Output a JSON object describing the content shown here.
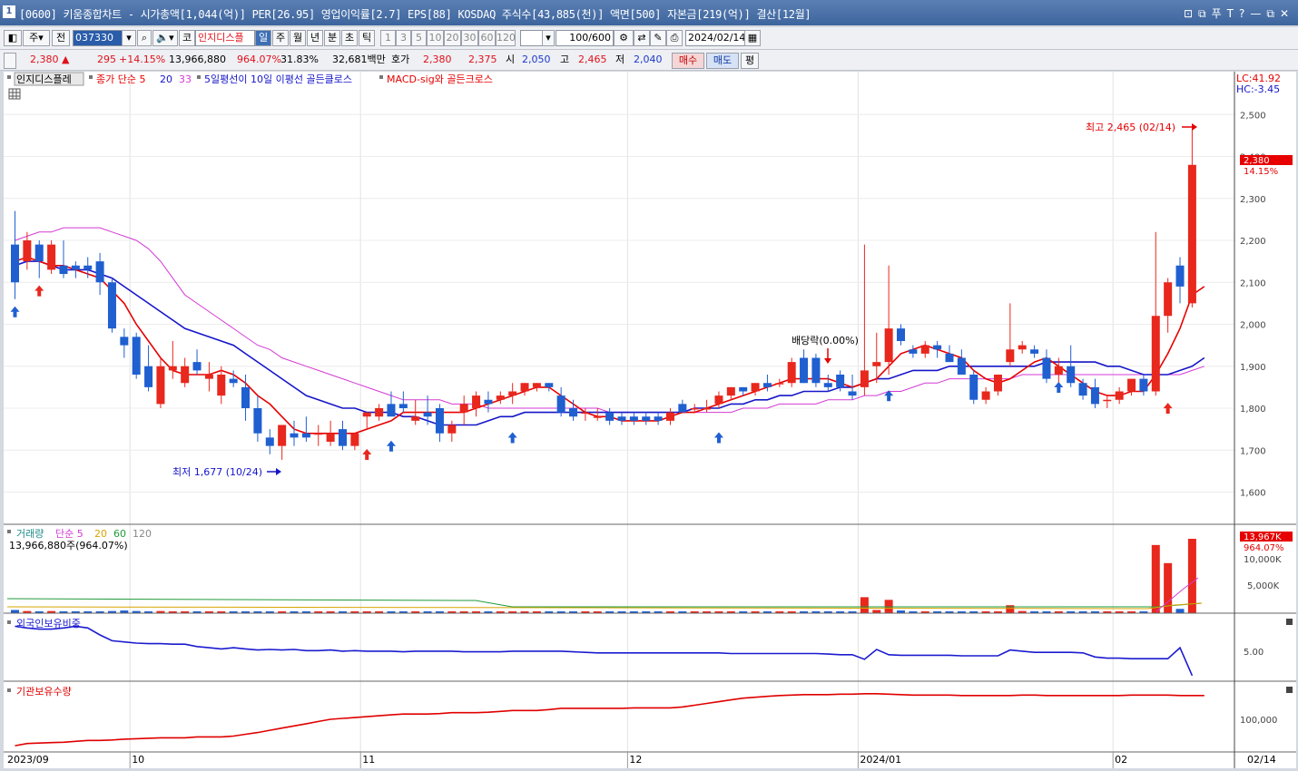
{
  "window": {
    "number": "1",
    "title": "[0600] 키움종합차트 - 시가총액[1,044(억)] PER[26.95] 영업이익률[2.7] EPS[88] KOSDAQ 주식수[43,885(천)] 액면[500] 자본금[219(억)] 결산[12월]",
    "buttons": [
      "⊡",
      "⧉",
      "푸",
      "T",
      "?",
      "—",
      "⧉",
      "✕"
    ]
  },
  "toolbar": {
    "period": "주",
    "scope": "전",
    "code": "037330",
    "stock_name": "인지디스플",
    "market_prefix": "코",
    "timeframes": [
      "일",
      "주",
      "월",
      "년",
      "분",
      "초",
      "틱"
    ],
    "selected_timeframe": "일",
    "intervals": [
      "1",
      "3",
      "5",
      "10",
      "20",
      "30",
      "60",
      "120"
    ],
    "count": "100/600",
    "date": "2024/02/14"
  },
  "quote": {
    "price": "2,380",
    "arrow": "▲",
    "change": "295",
    "change_pct": "+14.15%",
    "volume": "13,966,880",
    "volume_ratio": "964.07%",
    "turnover": "31.83%",
    "amount": "32,681백만",
    "ask_label": "호가",
    "ask": "2,380",
    "bid": "2,375",
    "open_label": "시",
    "open": "2,050",
    "high_label": "고",
    "high": "2,465",
    "low_label": "저",
    "low": "2,040",
    "buy_label": "매수",
    "sell_label": "매도",
    "eval_label": "평"
  },
  "legend": {
    "stock": "인지디스플레",
    "ma": "종가 단순 5",
    "ma20": "20",
    "ma33": "33",
    "sig1": "5일평선이 10일 이평선 골든클로스",
    "sig2": "MACD-sig와 골든크로스",
    "lc": "LC:41.92",
    "hc": "HC:-3.45",
    "high_note": "최고 2,465 (02/14)",
    "low_note": "최저 1,677 (10/24)",
    "dividend_note": "배당락(0.00%)",
    "last_price": "2,380",
    "last_pct": "14.15%"
  },
  "volume_panel": {
    "title": "거래량",
    "ma_label": "단순 5",
    "ma20": "20",
    "ma60": "60",
    "ma120": "120",
    "value_text": "13,966,880주(964.07%)",
    "last_value": "13,967K",
    "last_pct": "964.07%",
    "ticks": [
      "10,000K",
      "5,000K"
    ]
  },
  "foreign_panel": {
    "title": "외국인보유비중",
    "tick": "5.00"
  },
  "inst_panel": {
    "title": "기관보유수량",
    "tick": "100,000"
  },
  "xaxis": {
    "labels": [
      "2023/09",
      "10",
      "11",
      "12",
      "2024/01",
      "02",
      "02/14"
    ]
  },
  "colors": {
    "up": "#e8271d",
    "down": "#1f5fd0",
    "ma5": "#e60000",
    "ma20": "#1515c8",
    "ma33": "#d43ad4",
    "vol_ma20": "#d8a400",
    "vol_ma60": "#1f9a3a",
    "vol_ma120": "#888888",
    "foreign": "#1b1bd0",
    "inst": "#e00000"
  },
  "chart_data": {
    "type": "candlestick",
    "ylim": [
      1560,
      2520
    ],
    "y_ticks": [
      2500,
      2400,
      2300,
      2200,
      2100,
      2000,
      1900,
      1800,
      1700,
      1600
    ],
    "candles": [
      {
        "o": 2190,
        "h": 2270,
        "l": 2060,
        "c": 2100
      },
      {
        "o": 2150,
        "h": 2220,
        "l": 2130,
        "c": 2200
      },
      {
        "o": 2190,
        "h": 2200,
        "l": 2110,
        "c": 2150
      },
      {
        "o": 2130,
        "h": 2200,
        "l": 2120,
        "c": 2190
      },
      {
        "o": 2140,
        "h": 2200,
        "l": 2110,
        "c": 2120
      },
      {
        "o": 2140,
        "h": 2150,
        "l": 2110,
        "c": 2130
      },
      {
        "o": 2140,
        "h": 2160,
        "l": 2110,
        "c": 2130
      },
      {
        "o": 2150,
        "h": 2170,
        "l": 2070,
        "c": 2100
      },
      {
        "o": 2100,
        "h": 2110,
        "l": 1980,
        "c": 1990
      },
      {
        "o": 1970,
        "h": 1990,
        "l": 1920,
        "c": 1950
      },
      {
        "o": 1970,
        "h": 1980,
        "l": 1870,
        "c": 1880
      },
      {
        "o": 1900,
        "h": 1950,
        "l": 1840,
        "c": 1850
      },
      {
        "o": 1810,
        "h": 1920,
        "l": 1800,
        "c": 1900
      },
      {
        "o": 1890,
        "h": 1960,
        "l": 1870,
        "c": 1900
      },
      {
        "o": 1860,
        "h": 1920,
        "l": 1850,
        "c": 1900
      },
      {
        "o": 1910,
        "h": 1940,
        "l": 1880,
        "c": 1890
      },
      {
        "o": 1870,
        "h": 1910,
        "l": 1840,
        "c": 1880
      },
      {
        "o": 1830,
        "h": 1900,
        "l": 1810,
        "c": 1880
      },
      {
        "o": 1870,
        "h": 1890,
        "l": 1850,
        "c": 1860
      },
      {
        "o": 1850,
        "h": 1880,
        "l": 1770,
        "c": 1800
      },
      {
        "o": 1800,
        "h": 1830,
        "l": 1720,
        "c": 1740
      },
      {
        "o": 1730,
        "h": 1750,
        "l": 1690,
        "c": 1710
      },
      {
        "o": 1710,
        "h": 1760,
        "l": 1677,
        "c": 1760
      },
      {
        "o": 1740,
        "h": 1770,
        "l": 1710,
        "c": 1730
      },
      {
        "o": 1740,
        "h": 1780,
        "l": 1720,
        "c": 1730
      },
      {
        "o": 1740,
        "h": 1760,
        "l": 1710,
        "c": 1740
      },
      {
        "o": 1720,
        "h": 1770,
        "l": 1710,
        "c": 1740
      },
      {
        "o": 1750,
        "h": 1770,
        "l": 1700,
        "c": 1710
      },
      {
        "o": 1710,
        "h": 1740,
        "l": 1700,
        "c": 1740
      },
      {
        "o": 1780,
        "h": 1790,
        "l": 1750,
        "c": 1790
      },
      {
        "o": 1780,
        "h": 1810,
        "l": 1770,
        "c": 1800
      },
      {
        "o": 1810,
        "h": 1840,
        "l": 1790,
        "c": 1780
      },
      {
        "o": 1810,
        "h": 1840,
        "l": 1790,
        "c": 1800
      },
      {
        "o": 1770,
        "h": 1820,
        "l": 1760,
        "c": 1780
      },
      {
        "o": 1790,
        "h": 1830,
        "l": 1760,
        "c": 1780
      },
      {
        "o": 1800,
        "h": 1810,
        "l": 1720,
        "c": 1740
      },
      {
        "o": 1740,
        "h": 1770,
        "l": 1720,
        "c": 1760
      },
      {
        "o": 1790,
        "h": 1830,
        "l": 1760,
        "c": 1810
      },
      {
        "o": 1800,
        "h": 1840,
        "l": 1780,
        "c": 1830
      },
      {
        "o": 1820,
        "h": 1840,
        "l": 1790,
        "c": 1810
      },
      {
        "o": 1820,
        "h": 1840,
        "l": 1810,
        "c": 1830
      },
      {
        "o": 1830,
        "h": 1860,
        "l": 1810,
        "c": 1840
      },
      {
        "o": 1840,
        "h": 1860,
        "l": 1830,
        "c": 1860
      },
      {
        "o": 1850,
        "h": 1860,
        "l": 1840,
        "c": 1860
      },
      {
        "o": 1860,
        "h": 1860,
        "l": 1840,
        "c": 1850
      },
      {
        "o": 1830,
        "h": 1850,
        "l": 1780,
        "c": 1790
      },
      {
        "o": 1800,
        "h": 1820,
        "l": 1770,
        "c": 1780
      },
      {
        "o": 1790,
        "h": 1800,
        "l": 1770,
        "c": 1790
      },
      {
        "o": 1780,
        "h": 1800,
        "l": 1770,
        "c": 1780
      },
      {
        "o": 1790,
        "h": 1800,
        "l": 1760,
        "c": 1770
      },
      {
        "o": 1780,
        "h": 1790,
        "l": 1760,
        "c": 1770
      },
      {
        "o": 1780,
        "h": 1790,
        "l": 1760,
        "c": 1770
      },
      {
        "o": 1780,
        "h": 1790,
        "l": 1760,
        "c": 1770
      },
      {
        "o": 1780,
        "h": 1790,
        "l": 1760,
        "c": 1770
      },
      {
        "o": 1770,
        "h": 1800,
        "l": 1760,
        "c": 1790
      },
      {
        "o": 1810,
        "h": 1820,
        "l": 1790,
        "c": 1790
      },
      {
        "o": 1800,
        "h": 1810,
        "l": 1790,
        "c": 1800
      },
      {
        "o": 1800,
        "h": 1820,
        "l": 1790,
        "c": 1800
      },
      {
        "o": 1810,
        "h": 1840,
        "l": 1800,
        "c": 1830
      },
      {
        "o": 1830,
        "h": 1850,
        "l": 1820,
        "c": 1850
      },
      {
        "o": 1850,
        "h": 1850,
        "l": 1830,
        "c": 1840
      },
      {
        "o": 1840,
        "h": 1860,
        "l": 1830,
        "c": 1860
      },
      {
        "o": 1860,
        "h": 1880,
        "l": 1840,
        "c": 1850
      },
      {
        "o": 1860,
        "h": 1870,
        "l": 1850,
        "c": 1860
      },
      {
        "o": 1860,
        "h": 1920,
        "l": 1850,
        "c": 1910
      },
      {
        "o": 1920,
        "h": 1940,
        "l": 1860,
        "c": 1860
      },
      {
        "o": 1920,
        "h": 1930,
        "l": 1850,
        "c": 1860
      },
      {
        "o": 1860,
        "h": 1880,
        "l": 1840,
        "c": 1850
      },
      {
        "o": 1880,
        "h": 1890,
        "l": 1840,
        "c": 1850
      },
      {
        "o": 1840,
        "h": 1880,
        "l": 1820,
        "c": 1830
      },
      {
        "o": 1850,
        "h": 2190,
        "l": 1830,
        "c": 1890
      },
      {
        "o": 1900,
        "h": 1980,
        "l": 1860,
        "c": 1910
      },
      {
        "o": 1910,
        "h": 2140,
        "l": 1880,
        "c": 1990
      },
      {
        "o": 1990,
        "h": 2000,
        "l": 1950,
        "c": 1960
      },
      {
        "o": 1940,
        "h": 1950,
        "l": 1920,
        "c": 1930
      },
      {
        "o": 1930,
        "h": 1960,
        "l": 1920,
        "c": 1950
      },
      {
        "o": 1950,
        "h": 1960,
        "l": 1920,
        "c": 1940
      },
      {
        "o": 1930,
        "h": 1950,
        "l": 1910,
        "c": 1910
      },
      {
        "o": 1920,
        "h": 1940,
        "l": 1880,
        "c": 1880
      },
      {
        "o": 1880,
        "h": 1890,
        "l": 1810,
        "c": 1820
      },
      {
        "o": 1820,
        "h": 1850,
        "l": 1810,
        "c": 1840
      },
      {
        "o": 1840,
        "h": 1880,
        "l": 1830,
        "c": 1880
      },
      {
        "o": 1910,
        "h": 2050,
        "l": 1900,
        "c": 1940
      },
      {
        "o": 1940,
        "h": 1960,
        "l": 1930,
        "c": 1950
      },
      {
        "o": 1940,
        "h": 1950,
        "l": 1920,
        "c": 1930
      },
      {
        "o": 1920,
        "h": 1940,
        "l": 1860,
        "c": 1870
      },
      {
        "o": 1880,
        "h": 1920,
        "l": 1860,
        "c": 1900
      },
      {
        "o": 1900,
        "h": 1950,
        "l": 1850,
        "c": 1860
      },
      {
        "o": 1860,
        "h": 1870,
        "l": 1820,
        "c": 1830
      },
      {
        "o": 1850,
        "h": 1870,
        "l": 1800,
        "c": 1810
      },
      {
        "o": 1820,
        "h": 1830,
        "l": 1800,
        "c": 1820
      },
      {
        "o": 1820,
        "h": 1850,
        "l": 1810,
        "c": 1840
      },
      {
        "o": 1840,
        "h": 1870,
        "l": 1830,
        "c": 1870
      },
      {
        "o": 1870,
        "h": 1880,
        "l": 1830,
        "c": 1840
      },
      {
        "o": 1840,
        "h": 2220,
        "l": 1830,
        "c": 2020
      },
      {
        "o": 2020,
        "h": 2110,
        "l": 1980,
        "c": 2100
      },
      {
        "o": 2140,
        "h": 2160,
        "l": 2050,
        "c": 2090
      },
      {
        "o": 2050,
        "h": 2465,
        "l": 2040,
        "c": 2380
      }
    ],
    "ma5": [
      2150,
      2160,
      2150,
      2140,
      2140,
      2130,
      2120,
      2110,
      2080,
      2050,
      2000,
      1960,
      1920,
      1890,
      1880,
      1880,
      1880,
      1890,
      1880,
      1860,
      1830,
      1810,
      1780,
      1750,
      1740,
      1740,
      1740,
      1740,
      1740,
      1750,
      1760,
      1770,
      1790,
      1790,
      1790,
      1790,
      1790,
      1790,
      1800,
      1810,
      1820,
      1830,
      1840,
      1850,
      1850,
      1830,
      1810,
      1790,
      1780,
      1780,
      1770,
      1770,
      1770,
      1770,
      1780,
      1790,
      1790,
      1800,
      1810,
      1820,
      1830,
      1840,
      1850,
      1860,
      1870,
      1870,
      1870,
      1870,
      1860,
      1850,
      1860,
      1870,
      1900,
      1930,
      1940,
      1950,
      1940,
      1930,
      1920,
      1890,
      1870,
      1860,
      1870,
      1890,
      1910,
      1920,
      1900,
      1880,
      1860,
      1840,
      1830,
      1830,
      1840,
      1840,
      1880,
      1930,
      1990,
      2070,
      2090
    ],
    "ma20": [
      2140,
      2150,
      2150,
      2140,
      2130,
      2130,
      2130,
      2120,
      2110,
      2090,
      2070,
      2050,
      2030,
      2010,
      1990,
      1980,
      1970,
      1960,
      1950,
      1930,
      1910,
      1890,
      1870,
      1850,
      1830,
      1820,
      1810,
      1800,
      1800,
      1790,
      1790,
      1790,
      1780,
      1780,
      1770,
      1760,
      1760,
      1760,
      1760,
      1770,
      1780,
      1780,
      1790,
      1790,
      1790,
      1790,
      1790,
      1790,
      1790,
      1790,
      1790,
      1790,
      1790,
      1790,
      1790,
      1790,
      1800,
      1800,
      1800,
      1810,
      1810,
      1820,
      1820,
      1830,
      1830,
      1840,
      1840,
      1840,
      1850,
      1850,
      1860,
      1870,
      1870,
      1880,
      1890,
      1890,
      1890,
      1900,
      1900,
      1900,
      1900,
      1900,
      1900,
      1900,
      1900,
      1910,
      1910,
      1910,
      1910,
      1910,
      1900,
      1900,
      1890,
      1880,
      1880,
      1880,
      1890,
      1900,
      1920
    ],
    "ma33": [
      2200,
      2210,
      2220,
      2220,
      2230,
      2230,
      2230,
      2230,
      2220,
      2210,
      2200,
      2180,
      2150,
      2110,
      2070,
      2050,
      2030,
      2010,
      1990,
      1970,
      1950,
      1940,
      1920,
      1910,
      1900,
      1890,
      1880,
      1870,
      1860,
      1850,
      1840,
      1830,
      1820,
      1820,
      1820,
      1820,
      1810,
      1810,
      1810,
      1800,
      1800,
      1800,
      1800,
      1800,
      1800,
      1800,
      1800,
      1800,
      1800,
      1790,
      1790,
      1790,
      1790,
      1790,
      1790,
      1790,
      1790,
      1790,
      1790,
      1790,
      1800,
      1800,
      1800,
      1810,
      1810,
      1810,
      1810,
      1820,
      1820,
      1820,
      1830,
      1830,
      1840,
      1840,
      1850,
      1860,
      1860,
      1870,
      1870,
      1870,
      1870,
      1870,
      1870,
      1880,
      1880,
      1880,
      1880,
      1880,
      1880,
      1880,
      1880,
      1880,
      1880,
      1880,
      1880,
      1880,
      1880,
      1890,
      1900
    ],
    "volume": [
      0.6,
      0.4,
      0.3,
      0.4,
      0.3,
      0.2,
      0.3,
      0.3,
      0.4,
      0.5,
      0.4,
      0.3,
      0.4,
      0.3,
      0.3,
      0.3,
      0.3,
      0.3,
      0.2,
      0.2,
      0.3,
      0.3,
      0.3,
      0.2,
      0.2,
      0.2,
      0.2,
      0.2,
      0.2,
      0.2,
      0.2,
      0.2,
      0.2,
      0.2,
      0.2,
      0.2,
      0.2,
      0.2,
      0.2,
      0.2,
      0.2,
      0.2,
      0.2,
      0.2,
      0.2,
      0.2,
      0.2,
      0.2,
      0.2,
      0.2,
      0.2,
      0.2,
      0.2,
      0.2,
      0.2,
      0.2,
      0.2,
      0.2,
      0.2,
      0.2,
      0.2,
      0.2,
      0.2,
      0.2,
      0.2,
      0.2,
      0.2,
      0.2,
      0.2,
      0.2,
      3.0,
      0.6,
      2.5,
      0.5,
      0.3,
      0.3,
      0.3,
      0.3,
      0.3,
      0.3,
      0.3,
      0.3,
      1.5,
      0.4,
      0.3,
      0.3,
      0.3,
      0.3,
      0.3,
      0.3,
      0.3,
      0.3,
      0.3,
      0.3,
      12.8,
      9.4,
      0.8,
      13.967
    ],
    "foreign_pct": [
      5.35,
      5.32,
      5.3,
      5.3,
      5.32,
      5.35,
      5.32,
      5.2,
      5.1,
      5.08,
      5.06,
      5.05,
      5.05,
      5.04,
      5.04,
      5.0,
      4.98,
      4.96,
      4.98,
      4.96,
      4.94,
      4.95,
      4.94,
      4.95,
      4.93,
      4.93,
      4.94,
      4.92,
      4.93,
      4.92,
      4.92,
      4.92,
      4.91,
      4.92,
      4.92,
      4.92,
      4.92,
      4.91,
      4.91,
      4.91,
      4.91,
      4.92,
      4.92,
      4.92,
      4.92,
      4.92,
      4.91,
      4.9,
      4.89,
      4.89,
      4.89,
      4.89,
      4.89,
      4.89,
      4.89,
      4.89,
      4.89,
      4.89,
      4.89,
      4.88,
      4.88,
      4.88,
      4.88,
      4.88,
      4.88,
      4.88,
      4.88,
      4.87,
      4.86,
      4.86,
      4.78,
      4.95,
      4.86,
      4.85,
      4.85,
      4.85,
      4.85,
      4.85,
      4.84,
      4.84,
      4.84,
      4.84,
      4.94,
      4.92,
      4.9,
      4.9,
      4.9,
      4.9,
      4.89,
      4.82,
      4.8,
      4.8,
      4.79,
      4.79,
      4.79,
      4.79,
      4.98,
      4.5
    ],
    "inst_qty": [
      40000,
      45000,
      46000,
      47000,
      48000,
      50000,
      52000,
      52000,
      53000,
      55000,
      56000,
      57000,
      58000,
      58000,
      58000,
      60000,
      60000,
      60000,
      62000,
      66000,
      70000,
      75000,
      80000,
      85000,
      90000,
      95000,
      100000,
      102000,
      104000,
      106000,
      108000,
      110000,
      112000,
      112000,
      112000,
      113000,
      115000,
      115000,
      115000,
      116000,
      118000,
      120000,
      120000,
      120000,
      122000,
      125000,
      125000,
      125000,
      125000,
      125000,
      125000,
      126000,
      126000,
      126000,
      126000,
      128000,
      132000,
      136000,
      140000,
      144000,
      148000,
      150000,
      152000,
      154000,
      155000,
      156000,
      156000,
      156000,
      157000,
      157000,
      158000,
      158000,
      157000,
      156000,
      155000,
      155000,
      155000,
      155000,
      154000,
      154000,
      154000,
      154000,
      154000,
      155000,
      155000,
      154000,
      154000,
      154000,
      154000,
      154000,
      154000,
      154000,
      155000,
      155000,
      155000,
      155000,
      154000,
      154000,
      154000
    ]
  }
}
